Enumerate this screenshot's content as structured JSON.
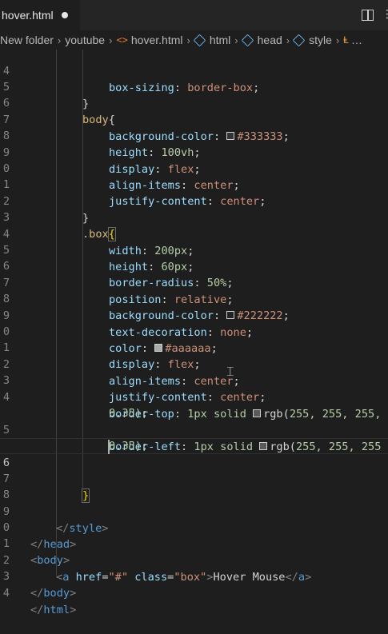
{
  "tab": {
    "filename": "hover.html"
  },
  "breadcrumb": [
    "New folder",
    "youtube",
    "hover.html",
    "html",
    "head",
    "style",
    "…"
  ],
  "colors": {
    "swatch_333": "#333333",
    "swatch_222": "#222222",
    "swatch_aaa": "#aaaaaa",
    "swatch_rgb": "#5a5a5a"
  },
  "lines": {
    "l14": {
      "n": "4",
      "code": "box-sizing: border-box;"
    },
    "l15": {
      "n": "5"
    },
    "l16": {
      "n": "6",
      "sel": "body"
    },
    "l17": {
      "n": "7",
      "prop": "background-color",
      "val": "#333333"
    },
    "l18": {
      "n": "8",
      "prop": "height",
      "num": "100vh"
    },
    "l19": {
      "n": "9",
      "prop": "display",
      "val": "flex"
    },
    "l20": {
      "n": "0",
      "prop": "align-items",
      "val": "center"
    },
    "l21": {
      "n": "1",
      "prop": "justify-content",
      "val": "center"
    },
    "l22": {
      "n": "2"
    },
    "l23": {
      "n": "3",
      "sel": ".box"
    },
    "l24": {
      "n": "4",
      "prop": "width",
      "num": "200px"
    },
    "l25": {
      "n": "5",
      "prop": "height",
      "num": "60px"
    },
    "l26": {
      "n": "6",
      "prop": "border-radius",
      "num": "50%"
    },
    "l27": {
      "n": "7",
      "prop": "position",
      "val": "relative"
    },
    "l28": {
      "n": "8",
      "prop": "background-color",
      "val": "#222222"
    },
    "l29": {
      "n": "9",
      "prop": "text-decoration",
      "val": "none"
    },
    "l30": {
      "n": "0",
      "prop": "color",
      "val": "#aaaaaa"
    },
    "l31": {
      "n": "1",
      "prop": "display",
      "val": "flex"
    },
    "l32": {
      "n": "2",
      "prop": "align-items",
      "val": "center"
    },
    "l33": {
      "n": "3",
      "prop": "justify-content",
      "val": "center"
    },
    "l34": {
      "n": "4",
      "prop": "border-top",
      "val1": "1px solid ",
      "fn": "rgb(",
      "args": "255, 255, 255,",
      "cont": "0.35);"
    },
    "l35": {
      "n": "5",
      "prop": "border-left",
      "val1": "1px solid ",
      "fn": "rgb(",
      "args": "255, 255, 255",
      "cont": "0.35);"
    },
    "l36": {
      "n": "6"
    },
    "l37": {
      "n": "7"
    },
    "l38": {
      "n": "8"
    },
    "l39": {
      "n": "9",
      "close_tag": "style"
    },
    "l40": {
      "n": "0",
      "close_tag": "head"
    },
    "l41": {
      "n": "1",
      "open_tag": "body"
    },
    "l42": {
      "n": "2",
      "tag": "a",
      "attr1": "href",
      "val1": "\"#\"",
      "attr2": "class",
      "val2": "\"box\"",
      "text": "Hover Mouse"
    },
    "l43": {
      "n": "3",
      "close_tag": "body"
    },
    "l44": {
      "n": "4",
      "close_tag": "html"
    }
  }
}
